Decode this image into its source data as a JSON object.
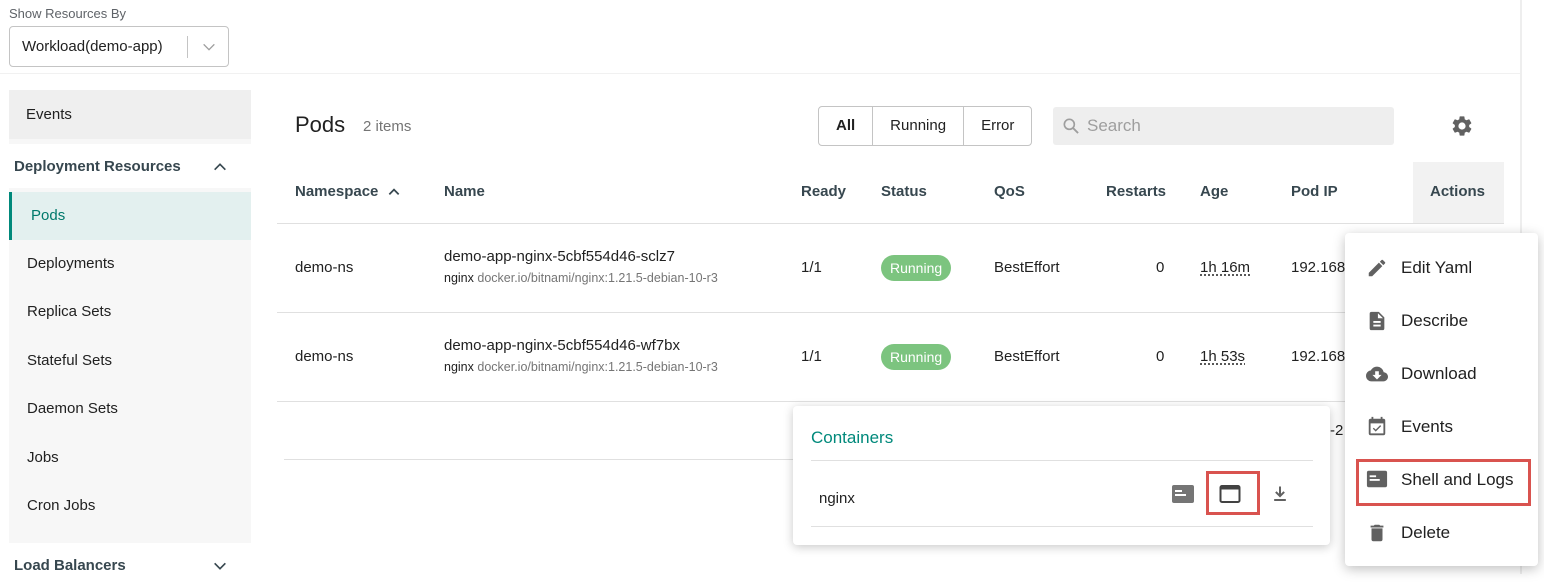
{
  "resources": {
    "label": "Show Resources By",
    "selected": "Workload(demo-app)"
  },
  "sidebar": {
    "events": "Events",
    "section": "Deployment Resources",
    "items": [
      "Pods",
      "Deployments",
      "Replica Sets",
      "Stateful Sets",
      "Daemon Sets",
      "Jobs",
      "Cron Jobs"
    ],
    "active": "Pods",
    "section2": "Load Balancers"
  },
  "pods": {
    "title": "Pods",
    "count": "2 items",
    "filters": [
      "All",
      "Running",
      "Error"
    ],
    "selected_filter": "All",
    "search_placeholder": "Search"
  },
  "table": {
    "columns": [
      "Namespace",
      "Name",
      "Ready",
      "Status",
      "QoS",
      "Restarts",
      "Age",
      "Pod IP",
      "Actions"
    ],
    "sort": {
      "column": "Namespace",
      "direction": "ascending"
    },
    "rows": [
      {
        "namespace": "demo-ns",
        "name": "demo-app-nginx-5cbf554d46-sclz7",
        "container": "nginx",
        "image": "docker.io/bitnami/nginx:1.21.5-debian-10-r3",
        "ready": "1/1",
        "status": "Running",
        "qos": "BestEffort",
        "restarts": "0",
        "age": "1h 16m",
        "pod_ip": "192.168"
      },
      {
        "namespace": "demo-ns",
        "name": "demo-app-nginx-5cbf554d46-wf7bx",
        "container": "nginx",
        "image": "docker.io/bitnami/nginx:1.21.5-debian-10-r3",
        "ready": "1/1",
        "status": "Running",
        "qos": "BestEffort",
        "restarts": "0",
        "age": "1h 53s",
        "pod_ip": "192.168"
      }
    ],
    "footer_fragment": "-2"
  },
  "containers_popup": {
    "title": "Containers",
    "items": [
      {
        "name": "nginx"
      }
    ]
  },
  "actions_menu": {
    "items": [
      {
        "label": "Edit Yaml",
        "icon": "pencil-icon"
      },
      {
        "label": "Describe",
        "icon": "document-icon"
      },
      {
        "label": "Download",
        "icon": "cloud-download-icon"
      },
      {
        "label": "Events",
        "icon": "calendar-check-icon"
      },
      {
        "label": "Shell and Logs",
        "icon": "terminal-icon"
      },
      {
        "label": "Delete",
        "icon": "trash-icon"
      }
    ],
    "highlighted": "Shell and Logs"
  },
  "colors": {
    "accent": "#00897b",
    "running": "#7cc47f",
    "highlight": "#d9534f"
  }
}
